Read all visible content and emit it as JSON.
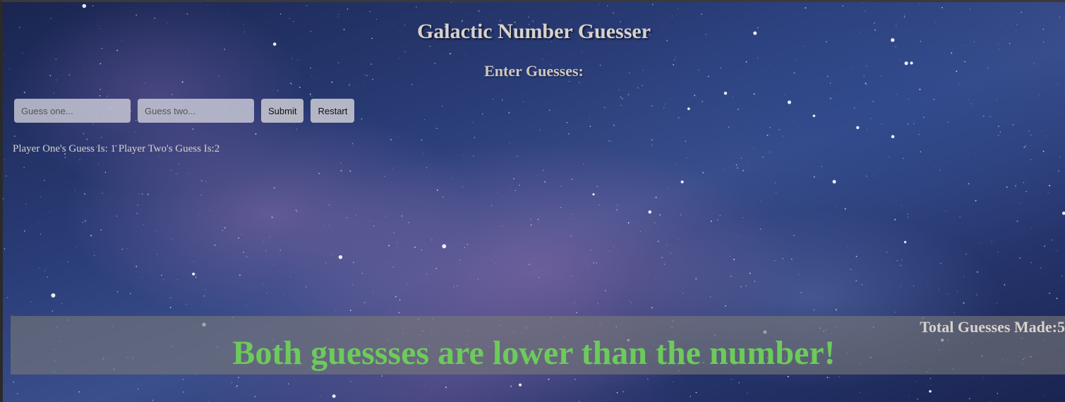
{
  "header": {
    "title": "Galactic Number Guesser",
    "subtitle": "Enter Guesses:"
  },
  "inputs": {
    "guess_one": {
      "placeholder": "Guess one...",
      "value": ""
    },
    "guess_two": {
      "placeholder": "Guess two...",
      "value": ""
    }
  },
  "buttons": {
    "submit_label": "Submit",
    "restart_label": "Restart"
  },
  "status": {
    "guess_summary": "Player One's Guess Is: 1 Player Two's Guess Is:2"
  },
  "results": {
    "total_guesses": "Total Guesses Made:5",
    "message": "Both guessses are lower than the number!"
  },
  "colors": {
    "result_message": "#6ccb5a",
    "text": "#d8d2cc",
    "result_bar": "#787878"
  }
}
